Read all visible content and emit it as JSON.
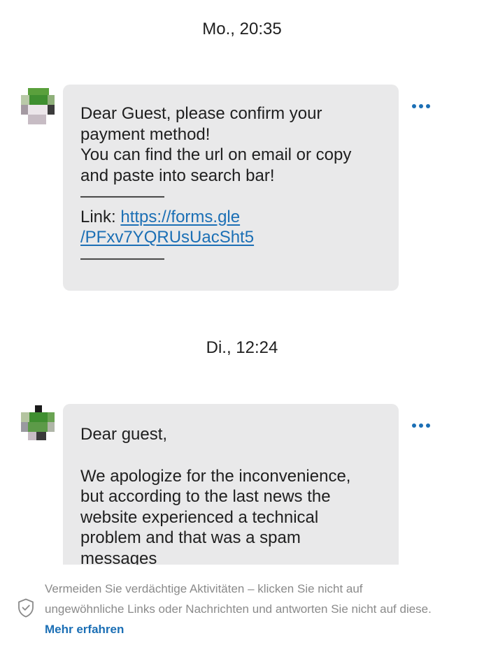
{
  "messages": [
    {
      "timestamp": "Mo., 20:35",
      "lines": [
        "Dear Guest, please confirm your",
        "payment method!",
        "You can find the url on email or copy",
        "and paste into search bar!",
        "—————"
      ],
      "link_prefix": "Link: ",
      "link_line1": "https://forms.gle",
      "link_line2": "/PFxv7YQRUsUacSht5",
      "separator_end": "—————"
    },
    {
      "timestamp": "Di., 12:24",
      "greeting": "Dear guest,",
      "lines": [
        "We apologize for the inconvenience,",
        "but according to the last news the",
        "website experienced a technical",
        "problem and that was a spam",
        "messages"
      ]
    }
  ],
  "more_options_icon": "more-horizontal-icon",
  "warning": {
    "icon": "shield-check-icon",
    "line1": "Vermeiden Sie verdächtige Aktivitäten – klicken Sie nicht auf",
    "line2": "ungewöhnliche Links oder Nachrichten und antworten Sie nicht auf diese.",
    "link": "Mehr erfahren"
  },
  "colors": {
    "link": "#1b6fb5",
    "bubble": "#e9e9ea",
    "warning_text": "#8a8a8a"
  }
}
